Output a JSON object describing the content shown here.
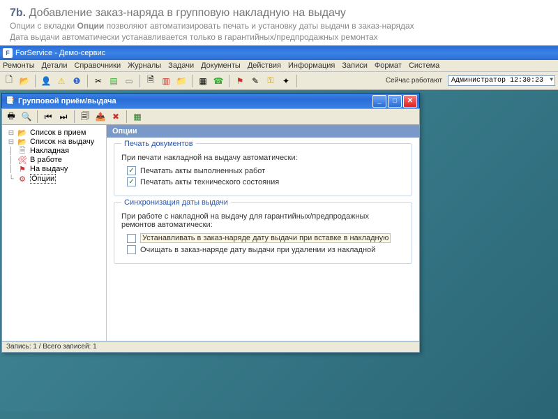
{
  "slide": {
    "num": "7b.",
    "title": " Добавление заказ-наряда в групповую накладную на выдачу",
    "line1a": "Опции с вкладки ",
    "line1b": "Опции",
    "line1c": " позволяют автоматизировать печать и установку даты выдачи в заказ-нарядах",
    "line2": "Дата выдачи автоматически устанавливается только в гарантийных/предпродажных ремонтах"
  },
  "mainApp": {
    "title": "ForService - Демо-сервис",
    "menus": [
      "Ремонты",
      "Детали",
      "Справочники",
      "Журналы",
      "Задачи",
      "Документы",
      "Действия",
      "Информация",
      "Записи",
      "Формат",
      "Система"
    ],
    "statusLabel": "Сейчас работают",
    "statusValue": "Администратор 12:30:23"
  },
  "dialog": {
    "title": "Групповой приём/выдача",
    "status": "Запись: 1 / Всего записей: 1"
  },
  "tree": {
    "items": [
      {
        "icon": "folder-open",
        "label": "Список в прием"
      },
      {
        "icon": "folder-open",
        "label": "Список на выдачу"
      },
      {
        "icon": "doc",
        "label": "Накладная"
      },
      {
        "icon": "doc",
        "label": "В работе"
      },
      {
        "icon": "doc",
        "label": "На выдачу"
      },
      {
        "icon": "gear",
        "label": "Опции"
      }
    ]
  },
  "options": {
    "header": "Опции",
    "group1": {
      "legend": "Печать документов",
      "intro": "При печати накладной на выдачу автоматически:",
      "chk1": "Печатать акты выполненных работ",
      "chk2": "Печатать акты технического состояния"
    },
    "group2": {
      "legend": "Синхронизация даты выдачи",
      "intro": "При работе с накладной на выдачу для гарантийных/предпродажных ремонтов автоматически:",
      "chk1": "Устанавливать в заказ-наряде дату выдачи при вставке в накладную",
      "chk2": "Очищать в заказ-наряде дату выдачи при удалении из накладной"
    }
  }
}
